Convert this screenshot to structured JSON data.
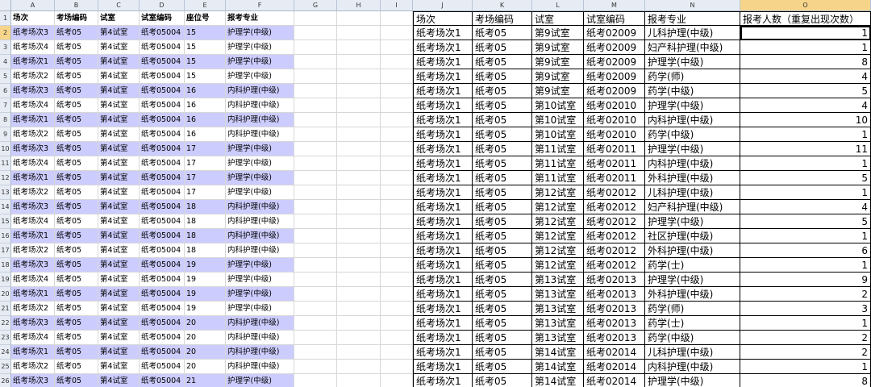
{
  "sheet": {
    "column_letters": [
      "A",
      "B",
      "C",
      "D",
      "E",
      "F",
      "G",
      "H",
      "I",
      "J",
      "K",
      "L",
      "M",
      "N",
      "O"
    ],
    "row_numbers": [
      "1",
      "2",
      "3",
      "4",
      "5",
      "6",
      "7",
      "8",
      "9",
      "10",
      "11",
      "12",
      "13",
      "14",
      "15",
      "16",
      "17",
      "18",
      "19",
      "20",
      "21",
      "22",
      "23",
      "24",
      "25",
      "26"
    ],
    "left_table": {
      "headers": [
        "场次",
        "考场编码",
        "试室",
        "试室编码",
        "座位号",
        "报考专业"
      ],
      "rows": [
        [
          "纸考场次3",
          "纸考05",
          "第4试室",
          "纸考05004",
          "15",
          "护理学(中级)"
        ],
        [
          "纸考场次4",
          "纸考05",
          "第4试室",
          "纸考05004",
          "15",
          "护理学(中级)"
        ],
        [
          "纸考场次1",
          "纸考05",
          "第4试室",
          "纸考05004",
          "15",
          "护理学(中级)"
        ],
        [
          "纸考场次2",
          "纸考05",
          "第4试室",
          "纸考05004",
          "15",
          "护理学(中级)"
        ],
        [
          "纸考场次3",
          "纸考05",
          "第4试室",
          "纸考05004",
          "16",
          "内科护理(中级)"
        ],
        [
          "纸考场次4",
          "纸考05",
          "第4试室",
          "纸考05004",
          "16",
          "内科护理(中级)"
        ],
        [
          "纸考场次1",
          "纸考05",
          "第4试室",
          "纸考05004",
          "16",
          "内科护理(中级)"
        ],
        [
          "纸考场次2",
          "纸考05",
          "第4试室",
          "纸考05004",
          "16",
          "内科护理(中级)"
        ],
        [
          "纸考场次3",
          "纸考05",
          "第4试室",
          "纸考05004",
          "17",
          "护理学(中级)"
        ],
        [
          "纸考场次4",
          "纸考05",
          "第4试室",
          "纸考05004",
          "17",
          "护理学(中级)"
        ],
        [
          "纸考场次1",
          "纸考05",
          "第4试室",
          "纸考05004",
          "17",
          "护理学(中级)"
        ],
        [
          "纸考场次2",
          "纸考05",
          "第4试室",
          "纸考05004",
          "17",
          "护理学(中级)"
        ],
        [
          "纸考场次3",
          "纸考05",
          "第4试室",
          "纸考05004",
          "18",
          "内科护理(中级)"
        ],
        [
          "纸考场次4",
          "纸考05",
          "第4试室",
          "纸考05004",
          "18",
          "内科护理(中级)"
        ],
        [
          "纸考场次1",
          "纸考05",
          "第4试室",
          "纸考05004",
          "18",
          "内科护理(中级)"
        ],
        [
          "纸考场次2",
          "纸考05",
          "第4试室",
          "纸考05004",
          "18",
          "内科护理(中级)"
        ],
        [
          "纸考场次3",
          "纸考05",
          "第4试室",
          "纸考05004",
          "19",
          "护理学(中级)"
        ],
        [
          "纸考场次4",
          "纸考05",
          "第4试室",
          "纸考05004",
          "19",
          "护理学(中级)"
        ],
        [
          "纸考场次1",
          "纸考05",
          "第4试室",
          "纸考05004",
          "19",
          "护理学(中级)"
        ],
        [
          "纸考场次2",
          "纸考05",
          "第4试室",
          "纸考05004",
          "19",
          "护理学(中级)"
        ],
        [
          "纸考场次3",
          "纸考05",
          "第4试室",
          "纸考05004",
          "20",
          "内科护理(中级)"
        ],
        [
          "纸考场次4",
          "纸考05",
          "第4试室",
          "纸考05004",
          "20",
          "内科护理(中级)"
        ],
        [
          "纸考场次1",
          "纸考05",
          "第4试室",
          "纸考05004",
          "20",
          "内科护理(中级)"
        ],
        [
          "纸考场次2",
          "纸考05",
          "第4试室",
          "纸考05004",
          "20",
          "内科护理(中级)"
        ],
        [
          "纸考场次3",
          "纸考05",
          "第4试室",
          "纸考05004",
          "21",
          "护理学(中级)"
        ]
      ]
    },
    "right_table": {
      "headers": [
        "场次",
        "考场编码",
        "试室",
        "试室编码",
        "报考专业",
        "报考人数（重复出现次数）"
      ],
      "rows": [
        [
          "纸考场次1",
          "纸考05",
          "第9试室",
          "纸考02009",
          "儿科护理(中级)",
          "1"
        ],
        [
          "纸考场次1",
          "纸考05",
          "第9试室",
          "纸考02009",
          "妇产科护理(中级)",
          "1"
        ],
        [
          "纸考场次1",
          "纸考05",
          "第9试室",
          "纸考02009",
          "护理学(中级)",
          "8"
        ],
        [
          "纸考场次1",
          "纸考05",
          "第9试室",
          "纸考02009",
          "药学(师)",
          "4"
        ],
        [
          "纸考场次1",
          "纸考05",
          "第9试室",
          "纸考02009",
          "药学(中级)",
          "5"
        ],
        [
          "纸考场次1",
          "纸考05",
          "第10试室",
          "纸考02010",
          "护理学(中级)",
          "4"
        ],
        [
          "纸考场次1",
          "纸考05",
          "第10试室",
          "纸考02010",
          "内科护理(中级)",
          "10"
        ],
        [
          "纸考场次1",
          "纸考05",
          "第10试室",
          "纸考02010",
          "药学(中级)",
          "1"
        ],
        [
          "纸考场次1",
          "纸考05",
          "第11试室",
          "纸考02011",
          "护理学(中级)",
          "11"
        ],
        [
          "纸考场次1",
          "纸考05",
          "第11试室",
          "纸考02011",
          "内科护理(中级)",
          "1"
        ],
        [
          "纸考场次1",
          "纸考05",
          "第11试室",
          "纸考02011",
          "外科护理(中级)",
          "5"
        ],
        [
          "纸考场次1",
          "纸考05",
          "第12试室",
          "纸考02012",
          "儿科护理(中级)",
          "1"
        ],
        [
          "纸考场次1",
          "纸考05",
          "第12试室",
          "纸考02012",
          "妇产科护理(中级)",
          "4"
        ],
        [
          "纸考场次1",
          "纸考05",
          "第12试室",
          "纸考02012",
          "护理学(中级)",
          "5"
        ],
        [
          "纸考场次1",
          "纸考05",
          "第12试室",
          "纸考02012",
          "社区护理(中级)",
          "1"
        ],
        [
          "纸考场次1",
          "纸考05",
          "第12试室",
          "纸考02012",
          "外科护理(中级)",
          "6"
        ],
        [
          "纸考场次1",
          "纸考05",
          "第12试室",
          "纸考02012",
          "药学(士)",
          "1"
        ],
        [
          "纸考场次1",
          "纸考05",
          "第13试室",
          "纸考02013",
          "护理学(中级)",
          "9"
        ],
        [
          "纸考场次1",
          "纸考05",
          "第13试室",
          "纸考02013",
          "外科护理(中级)",
          "2"
        ],
        [
          "纸考场次1",
          "纸考05",
          "第13试室",
          "纸考02013",
          "药学(师)",
          "3"
        ],
        [
          "纸考场次1",
          "纸考05",
          "第13试室",
          "纸考02013",
          "药学(士)",
          "1"
        ],
        [
          "纸考场次1",
          "纸考05",
          "第13试室",
          "纸考02013",
          "药学(中级)",
          "2"
        ],
        [
          "纸考场次1",
          "纸考05",
          "第14试室",
          "纸考02014",
          "儿科护理(中级)",
          "2"
        ],
        [
          "纸考场次1",
          "纸考05",
          "第14试室",
          "纸考02014",
          "内科护理(中级)",
          "1"
        ],
        [
          "纸考场次1",
          "纸考05",
          "第14试室",
          "纸考02014",
          "护理学(中级)",
          "8"
        ]
      ]
    },
    "colors": {
      "highlight_fill": "#ccccff",
      "header_bg": "#e7ecf4",
      "selected_header": "#f6d58a",
      "gridline": "#d7d7d7"
    }
  }
}
